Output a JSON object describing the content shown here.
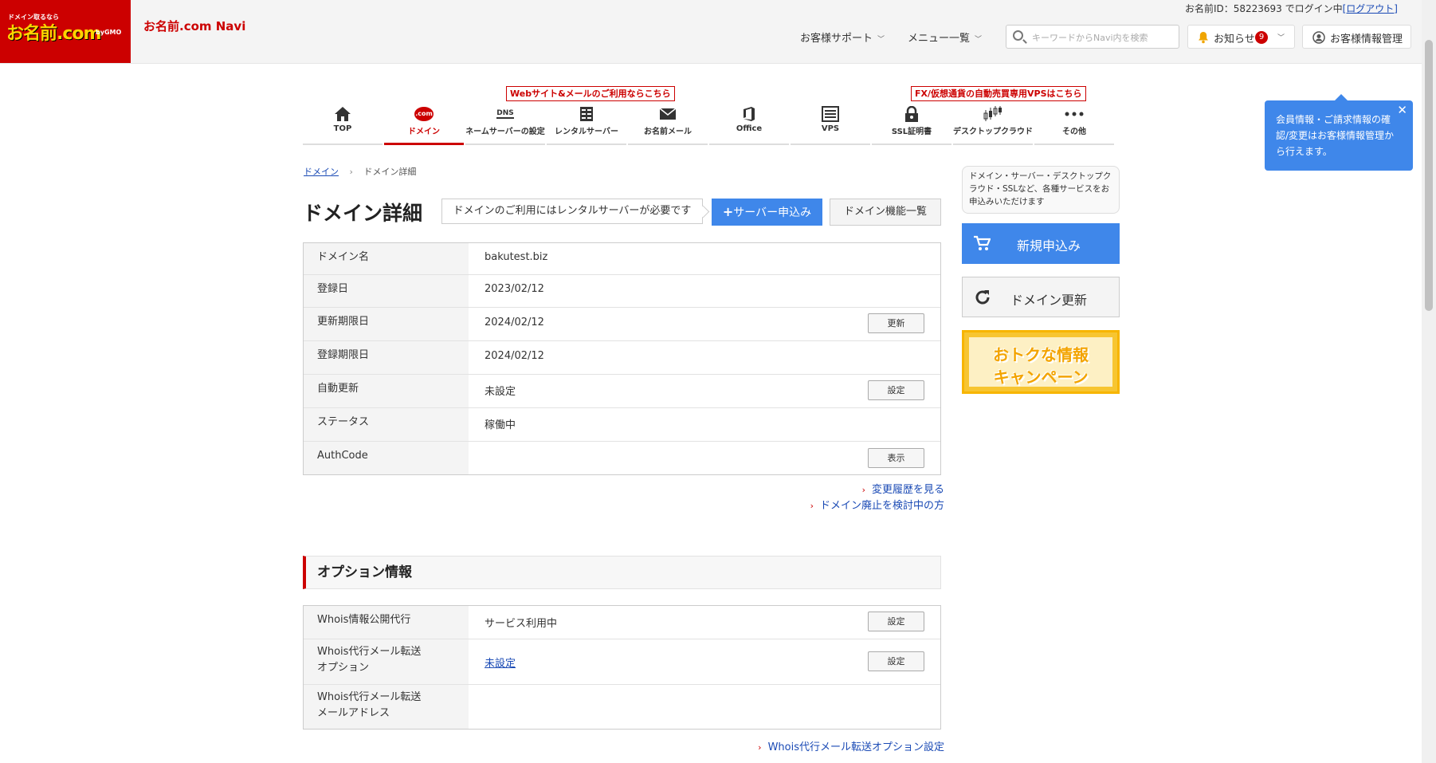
{
  "header": {
    "logo_small": "ドメイン取るなら",
    "logo_main": "お名前.com",
    "logo_gmo": "byGMO",
    "navi_title": "お名前.com Navi",
    "login_text": "お名前ID：58223693 でログイン中",
    "logout_label": "[ログアウト]",
    "support_menu": "お客様サポート",
    "menu_list": "メニュー一覧",
    "search_placeholder": "キーワードからNavi内を検索",
    "notifications_label": "お知らせ",
    "notifications_count": "9",
    "account_label": "お客様情報管理"
  },
  "callouts": {
    "web_mail": "Webサイト&メールのご利用ならこちら",
    "fx_vps": "FX/仮想通貨の自動売買専用VPSはこちら"
  },
  "gnav": {
    "items": [
      {
        "label": "TOP",
        "icon": "home-icon"
      },
      {
        "label": "ドメイン",
        "icon": "dotcom-icon"
      },
      {
        "label": "ネームサーバーの設定",
        "icon": "dns-icon"
      },
      {
        "label": "レンタルサーバー",
        "icon": "server-icon"
      },
      {
        "label": "お名前メール",
        "icon": "mail-icon"
      },
      {
        "label": "Office",
        "icon": "office-icon"
      },
      {
        "label": "VPS",
        "icon": "vps-icon"
      },
      {
        "label": "SSL証明書",
        "icon": "lock-icon"
      },
      {
        "label": "デスクトップクラウド",
        "icon": "candlestick-icon"
      },
      {
        "label": "その他",
        "icon": "more-icon"
      }
    ],
    "dotcom_text": ".com",
    "dns_text": "DNS"
  },
  "breadcrumb": {
    "parent": "ドメイン",
    "separator": "›",
    "current": "ドメイン詳細"
  },
  "page": {
    "title": "ドメイン詳細",
    "notice": "ドメインのご利用にはレンタルサーバーが必要です",
    "server_apply": "サーバー申込み",
    "domain_functions": "ドメイン機能一覧"
  },
  "domain_table": {
    "rows": [
      {
        "label": "ドメイン名",
        "value": "bakutest.biz",
        "button": ""
      },
      {
        "label": "登録日",
        "value": "2023/02/12",
        "button": ""
      },
      {
        "label": "更新期限日",
        "value": "2024/02/12",
        "button": "更新"
      },
      {
        "label": "登録期限日",
        "value": "2024/02/12",
        "button": ""
      },
      {
        "label": "自動更新",
        "value": "未設定",
        "button": "設定"
      },
      {
        "label": "ステータス",
        "value": "稼働中",
        "button": ""
      },
      {
        "label": "AuthCode",
        "value": "",
        "button": "表示"
      }
    ]
  },
  "links": {
    "change_history": "変更履歴を見る",
    "domain_abolish": "ドメイン廃止を検討中の方",
    "whois_forward_setting": "Whois代行メール転送オプション設定"
  },
  "options": {
    "heading": "オプション情報",
    "rows": [
      {
        "label": "Whois情報公開代行",
        "value": "サービス利用中",
        "button": "設定"
      },
      {
        "label_line1": "Whois代行メール転送",
        "label_line2": "オプション",
        "value": "未設定",
        "button": "設定"
      },
      {
        "label_line1": "Whois代行メール転送",
        "label_line2": "メールアドレス",
        "value": "",
        "button": ""
      }
    ]
  },
  "sidebar": {
    "info_text": "ドメイン・サーバー・デスクトップクラウド・SSLなど、各種サービスをお申込みいただけます",
    "new_apply": "新規申込み",
    "domain_renew": "ドメイン更新",
    "campaign_line1": "おトクな情報",
    "campaign_line2": "キャンペーン"
  },
  "tooltip": {
    "text": "会員情報・ご請求情報の確認/変更はお客様情報管理から行えます。",
    "close": "✕"
  }
}
